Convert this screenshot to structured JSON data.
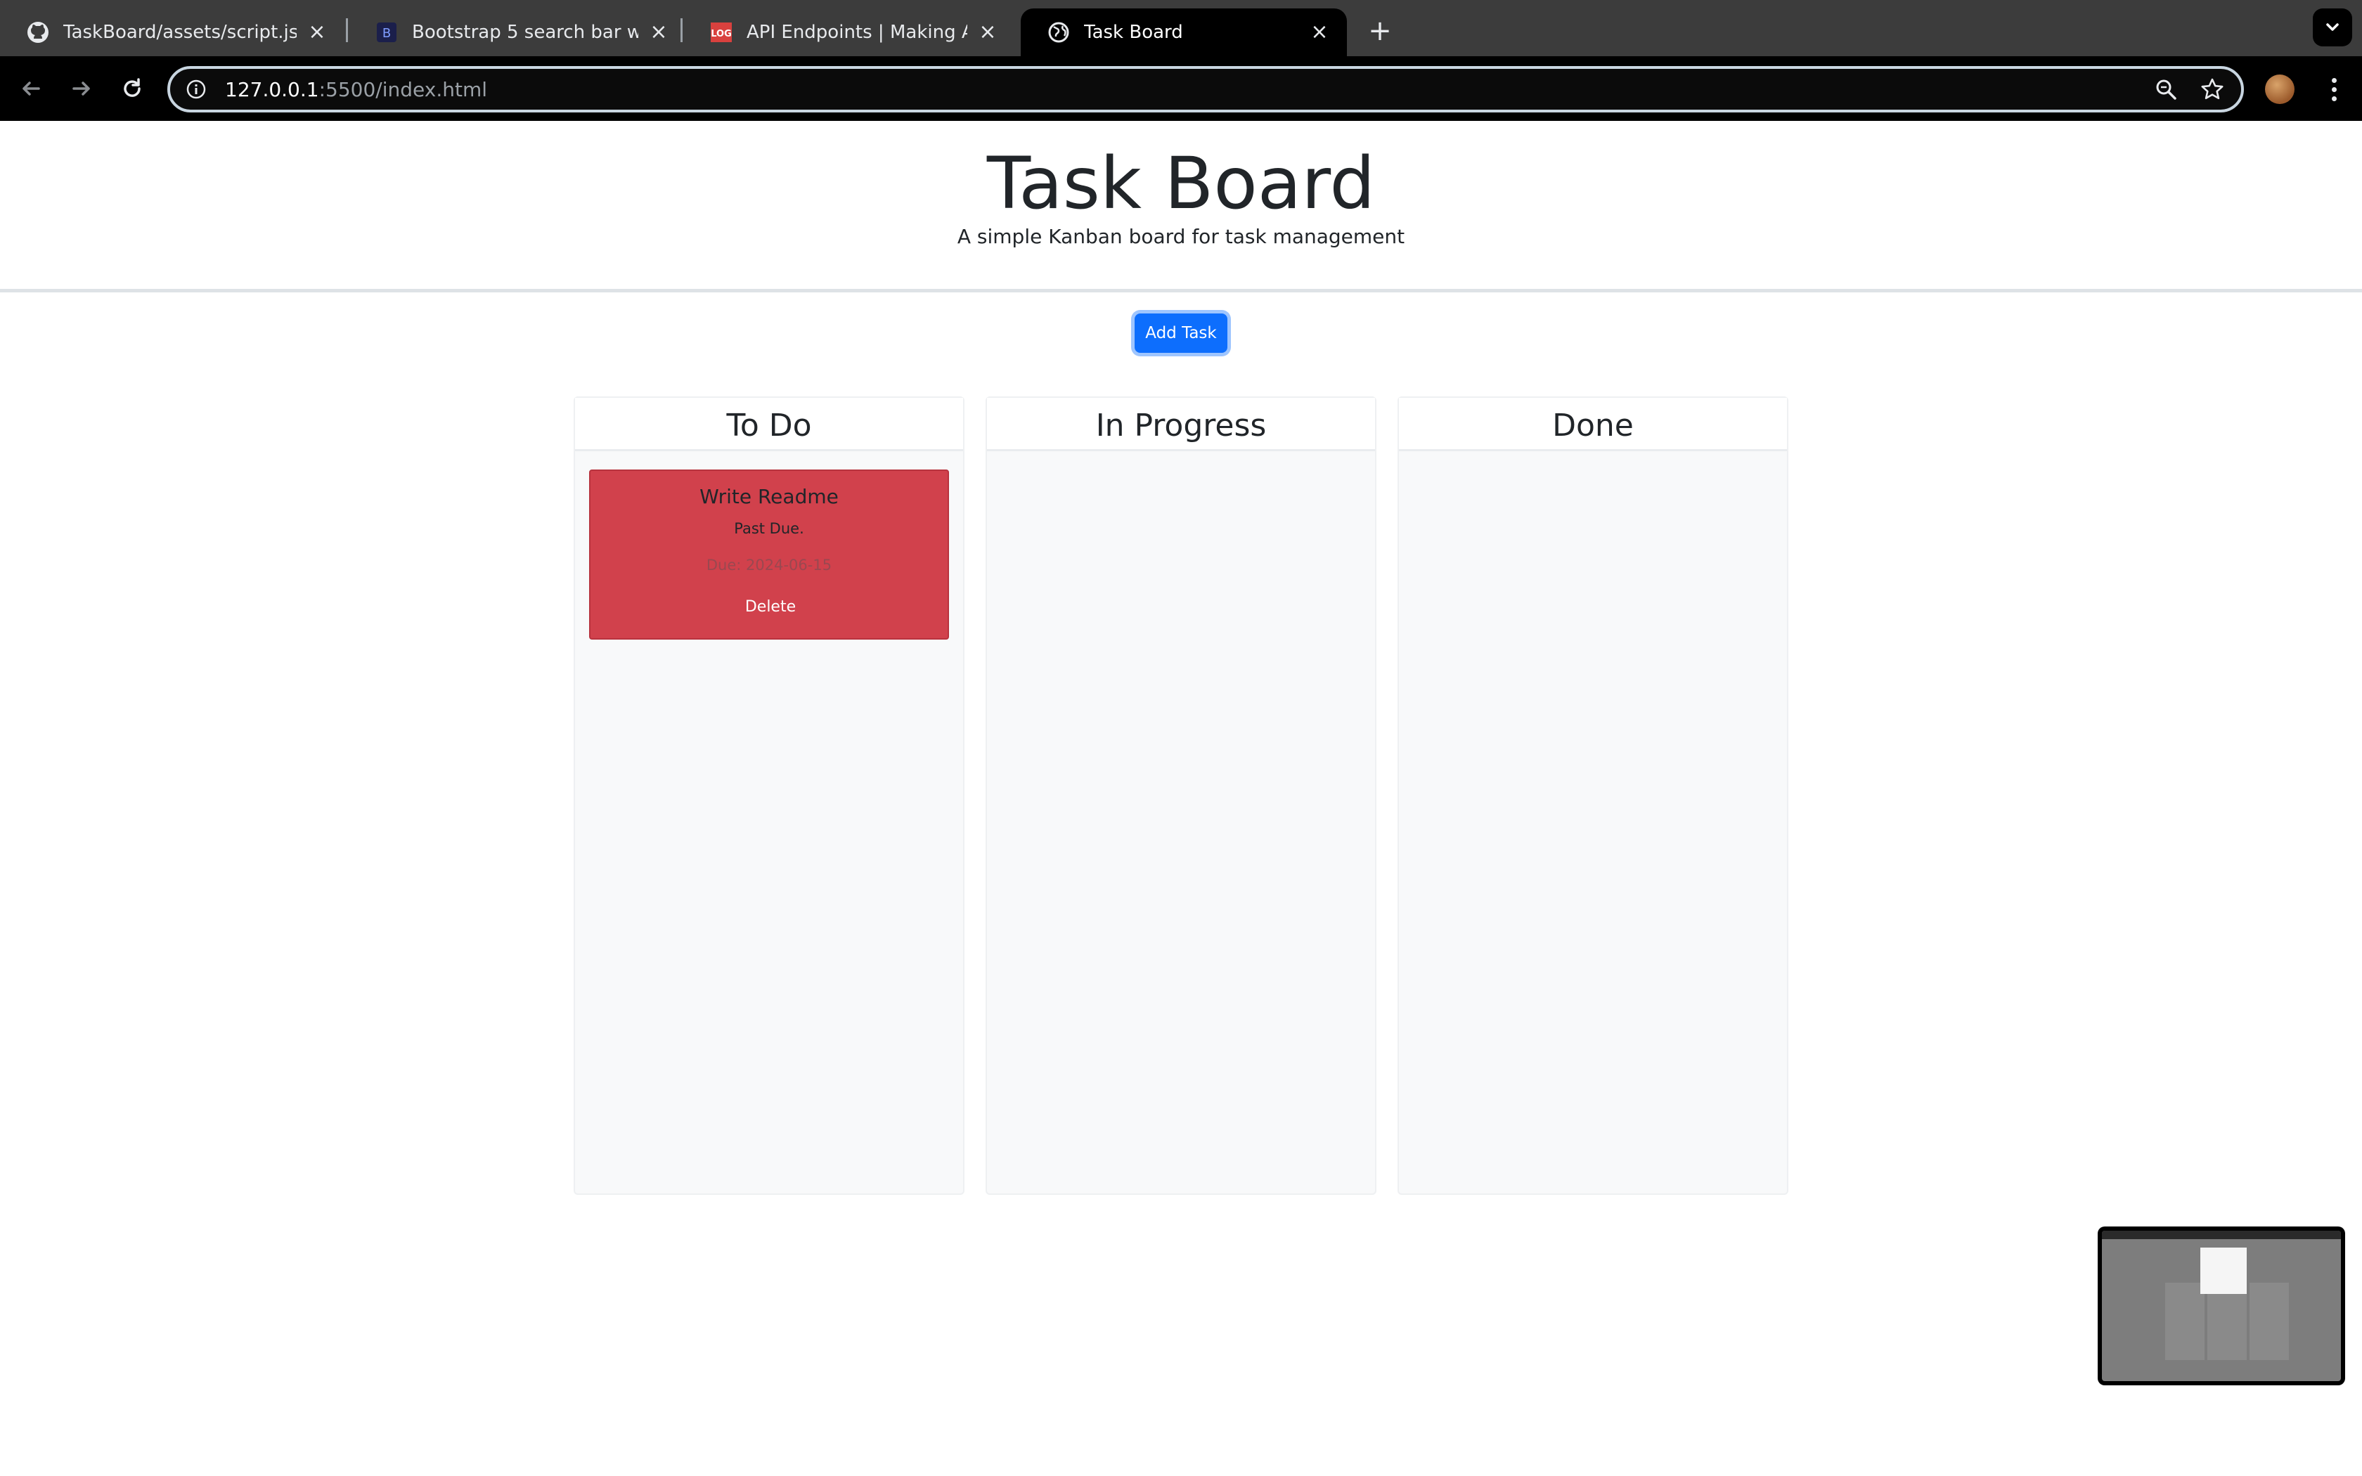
{
  "browser": {
    "tabs": [
      {
        "title": "TaskBoard/assets/script.js at",
        "favicon": "github-icon"
      },
      {
        "title": "Bootstrap 5 search bar with n",
        "favicon": "bootstrap-icon"
      },
      {
        "title": "API Endpoints | Making API R",
        "favicon": "log-icon"
      },
      {
        "title": "Task Board",
        "favicon": "globe-icon",
        "active": true
      }
    ],
    "url_host": "127.0.0.1",
    "url_rest": ":5500/index.html"
  },
  "page": {
    "title": "Task Board",
    "subtitle": "A simple Kanban board for task management",
    "add_button": "Add Task",
    "lanes": [
      {
        "title": "To Do"
      },
      {
        "title": "In Progress"
      },
      {
        "title": "Done"
      }
    ],
    "tasks": [
      {
        "title": "Write Readme",
        "description": "Past Due.",
        "due": "Due: 2024-06-15",
        "delete_label": "Delete",
        "status_color": "#d1414c"
      }
    ]
  },
  "colors": {
    "primary": "#0d6efd",
    "past_due": "#d1414c"
  }
}
